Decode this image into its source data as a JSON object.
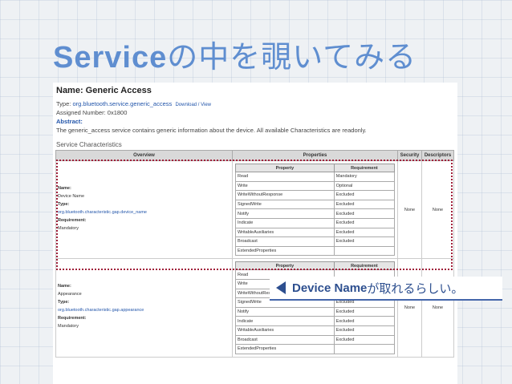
{
  "slide": {
    "title_latin": "Service",
    "title_jp": "の中を覗いてみる"
  },
  "doc": {
    "name": "Name: Generic Access",
    "type_prefix": "Type: ",
    "type_value": "org.bluetooth.service.generic_access",
    "type_links": "Download / View",
    "assigned_number": "Assigned Number: 0x1800",
    "abstract_label": "Abstract:",
    "abstract_text": "The generic_access service contains generic information about the device. All available Characteristics are readonly.",
    "section_title": "Service Characteristics",
    "columns": {
      "overview": "Overview",
      "properties": "Properties",
      "security": "Security",
      "descriptors": "Descriptors"
    },
    "prop_header": {
      "property": "Property",
      "requirement": "Requirement"
    },
    "characteristics": [
      {
        "name_label": "Name:",
        "name": "Device Name",
        "type_label": "Type:",
        "type": "org.bluetooth.characteristic.gap.device_name",
        "req_label": "Requirement:",
        "requirement": "Mandatory",
        "security": "None",
        "descriptors": "None",
        "properties": [
          [
            "Read",
            "Mandatory"
          ],
          [
            "Write",
            "Optional"
          ],
          [
            "WriteWithoutResponse",
            "Excluded"
          ],
          [
            "SignedWrite",
            "Excluded"
          ],
          [
            "Notify",
            "Excluded"
          ],
          [
            "Indicate",
            "Excluded"
          ],
          [
            "WritableAuxiliaries",
            "Excluded"
          ],
          [
            "Broadcast",
            "Excluded"
          ],
          [
            "ExtendedProperties",
            ""
          ]
        ]
      },
      {
        "name_label": "Name:",
        "name": "Appearance",
        "type_label": "Type:",
        "type": "org.bluetooth.characteristic.gap.appearance",
        "req_label": "Requirement:",
        "requirement": "Mandatory",
        "security": "None",
        "descriptors": "None",
        "properties": [
          [
            "Read",
            ""
          ],
          [
            "Write",
            "Excluded"
          ],
          [
            "WriteWithoutResponse",
            "Excluded"
          ],
          [
            "SignedWrite",
            "Excluded"
          ],
          [
            "Notify",
            "Excluded"
          ],
          [
            "Indicate",
            "Excluded"
          ],
          [
            "WritableAuxiliaries",
            "Excluded"
          ],
          [
            "Broadcast",
            "Excluded"
          ],
          [
            "ExtendedProperties",
            ""
          ]
        ]
      }
    ]
  },
  "callout": {
    "emphasis": "Device Name",
    "text": "が取れるらしい。"
  },
  "colors": {
    "title": "#5f8ed0",
    "highlight": "#a0203a",
    "callout": "#2d4f8f"
  }
}
